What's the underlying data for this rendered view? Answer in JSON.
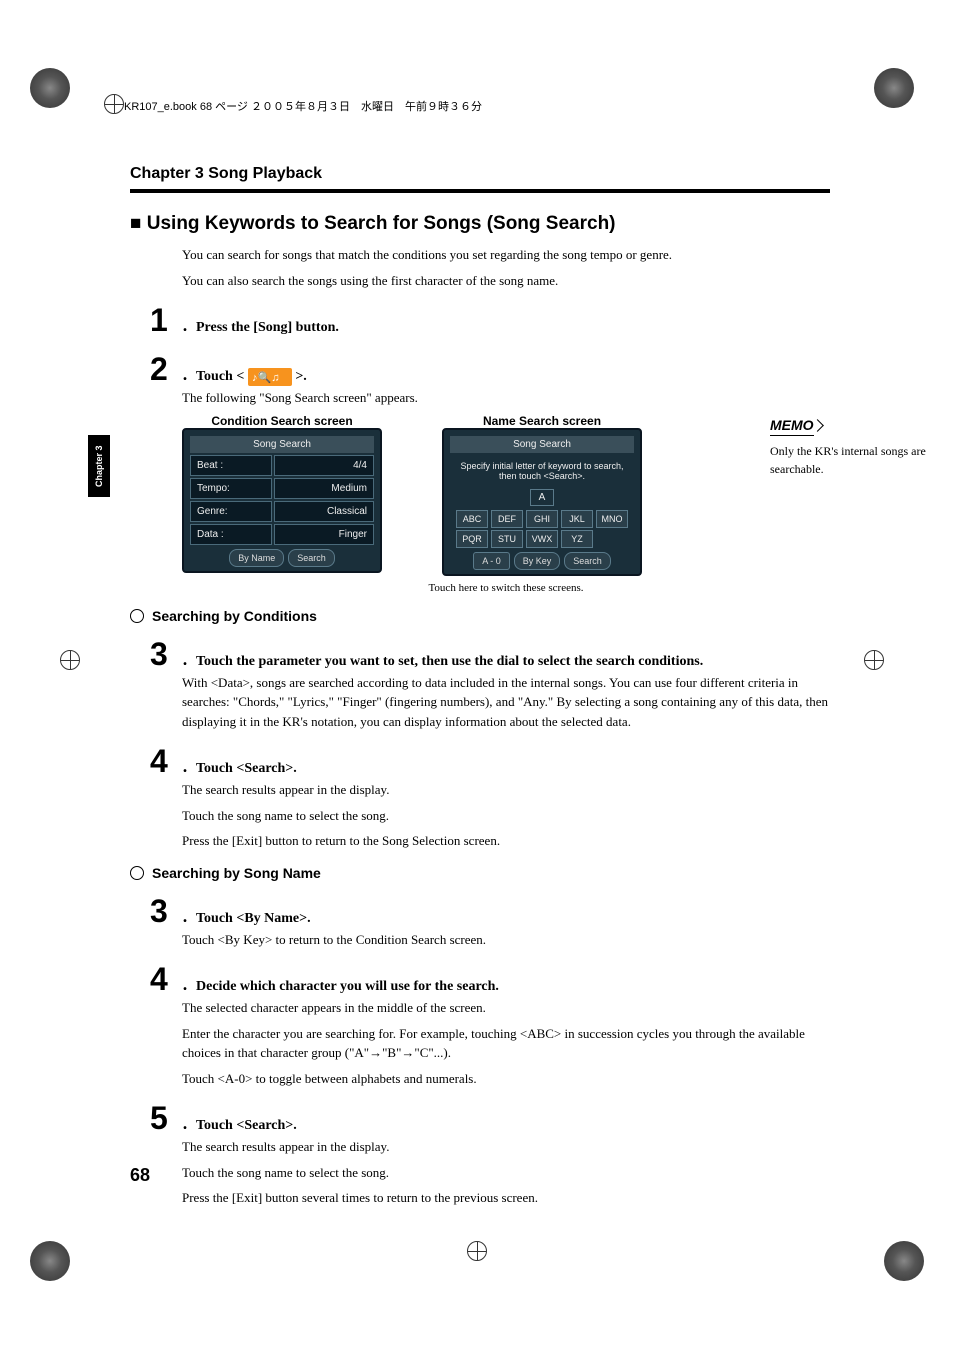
{
  "print_header": "KR107_e.book  68 ページ  ２００５年８月３日　水曜日　午前９時３６分",
  "chapter_title": "Chapter 3 Song Playback",
  "chapter_tab": "Chapter 3",
  "page_number": "68",
  "section": {
    "title": "■ Using Keywords to Search for Songs (Song Search)",
    "intro1": "You can search for songs that match the conditions you set regarding the song tempo or genre.",
    "intro2": "You can also search the songs using the first character of the song name."
  },
  "memo": {
    "label": "MEMO",
    "text": "Only the KR's internal songs are searchable."
  },
  "step1": {
    "num": "1",
    "text": "Press the [Song] button."
  },
  "step2": {
    "num": "2",
    "text_pre": "Touch < ",
    "text_post": " >.",
    "sub": "The following \"Song Search screen\" appears."
  },
  "screens": {
    "left_label": "Condition Search screen",
    "right_label": "Name Search screen",
    "switch_note": "Touch here to switch these screens."
  },
  "condition_screen": {
    "title": "Song Search",
    "rows": [
      {
        "label": "Beat :",
        "value": "4/4"
      },
      {
        "label": "Tempo:",
        "value": "Medium"
      },
      {
        "label": "Genre:",
        "value": "Classical"
      },
      {
        "label": "Data :",
        "value": "Finger"
      }
    ],
    "btn1": "By Name",
    "btn2": "Search"
  },
  "name_screen": {
    "title": "Song Search",
    "instruction": "Specify initial letter of keyword to search, then touch <Search>.",
    "current": "A",
    "keys1": [
      "ABC",
      "DEF",
      "GHI",
      "JKL",
      "MNO"
    ],
    "keys2": [
      "PQR",
      "STU",
      "VWX",
      "YZ",
      ""
    ],
    "btn_a0": "A - 0",
    "btn_bykey": "By Key",
    "btn_search": "Search"
  },
  "search_by_conditions": {
    "title": "Searching by Conditions",
    "step3": {
      "num": "3",
      "text": "Touch the parameter you want to set, then use the dial to select the search conditions.",
      "p1": "With <Data>, songs are searched according to data included in the internal songs. You can use four different criteria in searches: \"Chords,\" \"Lyrics,\" \"Finger\" (fingering numbers), and \"Any.\" By selecting a song containing any of this data, then displaying it in the KR's notation, you can display information about the selected data."
    },
    "step4": {
      "num": "4",
      "text": "Touch <Search>.",
      "p1": "The search results appear in the display.",
      "p2": "Touch the song name to select the song.",
      "p3": "Press the [Exit] button to return to the Song Selection screen."
    }
  },
  "search_by_name": {
    "title": "Searching by Song Name",
    "step3": {
      "num": "3",
      "text": "Touch <By Name>.",
      "p1": "Touch <By Key> to return to the Condition Search screen."
    },
    "step4": {
      "num": "4",
      "text": "Decide which character you will use for the search.",
      "p1": "The selected character appears in the middle of the screen.",
      "p2": "Enter the character you are searching for. For example, touching <ABC> in succession cycles you through the available choices in that character group (\"A\"→\"B\"→\"C\"...).",
      "p3": "Touch <A-0> to toggle between alphabets and numerals."
    },
    "step5": {
      "num": "5",
      "text": "Touch <Search>.",
      "p1": "The search results appear in the display.",
      "p2": "Touch the song name to select the song.",
      "p3": "Press the [Exit] button several times to return to the previous screen."
    }
  }
}
